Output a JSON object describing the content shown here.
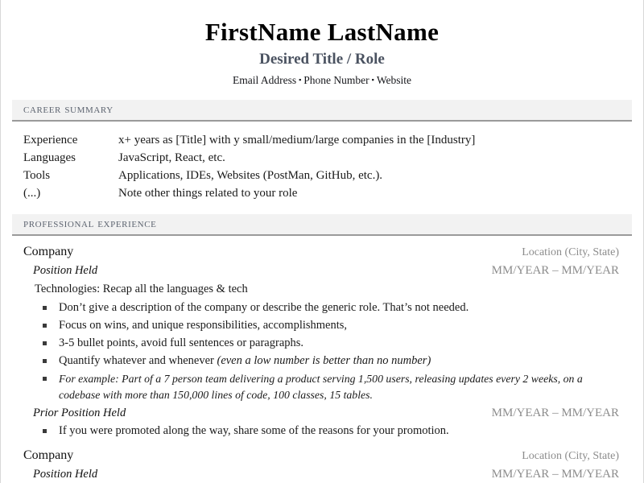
{
  "header": {
    "full_name": "FirstName LastName",
    "desired_title": "Desired Title / Role",
    "contact": {
      "email": "Email Address",
      "phone": "Phone Number",
      "website": "Website",
      "separator": "▪"
    }
  },
  "sections": {
    "career_summary": {
      "heading": "Career Summary",
      "rows": [
        {
          "label": "Experience",
          "value": "x+ years as [Title] with y small/medium/large companies in the [Industry]"
        },
        {
          "label": "Languages",
          "value": "JavaScript, React, etc."
        },
        {
          "label": "Tools",
          "value": "Applications, IDEs, Websites (PostMan, GitHub, etc.)."
        },
        {
          "label": "(...)",
          "value": "Note other things related to your role"
        }
      ]
    },
    "professional_experience": {
      "heading": "Professional Experience",
      "entries": [
        {
          "company": "Company",
          "location": "Location (City, State)",
          "position": "Position Held",
          "dates": "MM/YEAR – MM/YEAR",
          "technologies": "Technologies: Recap all the languages & tech",
          "bullets": [
            {
              "text": "Don’t give a description of the company or describe the generic role. That’s not needed.",
              "style": "normal"
            },
            {
              "text": "Focus on wins, and unique responsibilities, accomplishments,",
              "style": "normal"
            },
            {
              "text": "3-5 bullet points, avoid full sentences or paragraphs.",
              "style": "normal"
            },
            {
              "text": "Quantify whatever and whenever ",
              "italic_tail": "(even a low number is better than no number)",
              "style": "mixed"
            },
            {
              "text": "For example: Part of a 7 person team delivering a product serving 1,500 users, releasing updates every 2 weeks, on a codebase with more than 150,000 lines of code, 100 classes, 15 tables.",
              "style": "italic"
            }
          ],
          "prior_position": {
            "position": "Prior Position Held",
            "dates": "MM/YEAR – MM/YEAR",
            "bullets": [
              {
                "text": "If you were promoted along the way, share some of the reasons for your promotion.",
                "style": "normal"
              }
            ]
          }
        },
        {
          "company": "Company",
          "location": "Location (City, State)",
          "position": "Position Held",
          "dates": "MM/YEAR – MM/YEAR"
        }
      ]
    }
  },
  "colors": {
    "band_background": "#f2f2f2",
    "band_rule": "#9a9a9a",
    "heading_text": "#5d6470",
    "muted_text": "#8c8c8c",
    "body_text": "#1a1a1a",
    "title_text": "#4a5260"
  }
}
